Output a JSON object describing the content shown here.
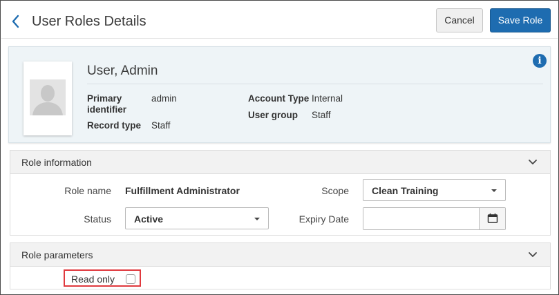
{
  "header": {
    "title": "User Roles Details",
    "back_icon": "chevron-left-icon",
    "cancel_label": "Cancel",
    "save_label": "Save Role"
  },
  "user": {
    "name": "User, Admin",
    "fields": {
      "primary_identifier_label_line1": "Primary",
      "primary_identifier_label_line2": "identifier",
      "primary_identifier_value": "admin",
      "record_type_label": "Record type",
      "record_type_value": "Staff",
      "account_type_label": "Account Type",
      "account_type_value": "Internal",
      "user_group_label": "User group",
      "user_group_value": "Staff"
    },
    "info_icon_glyph": "i"
  },
  "role_information": {
    "title": "Role information",
    "role_name_label": "Role name",
    "role_name_value": "Fulfillment Administrator",
    "scope_label": "Scope",
    "scope_value": "Clean Training",
    "status_label": "Status",
    "status_value": "Active",
    "expiry_label": "Expiry Date",
    "expiry_value": ""
  },
  "role_parameters": {
    "title": "Role parameters",
    "read_only_label": "Read only",
    "read_only_checked": false
  },
  "colors": {
    "accent": "#1e6cb0",
    "highlight_border": "#e0393e",
    "card_bg": "#eef4f7"
  }
}
